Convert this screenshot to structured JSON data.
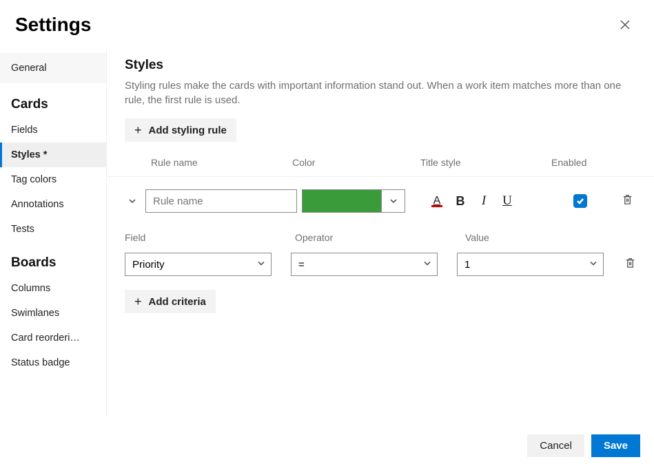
{
  "header": {
    "title": "Settings"
  },
  "sidebar": {
    "items": [
      {
        "label": "General",
        "type": "plain-first"
      },
      {
        "label": "Cards",
        "type": "group"
      },
      {
        "label": "Fields",
        "type": "plain"
      },
      {
        "label": "Styles *",
        "type": "active"
      },
      {
        "label": "Tag colors",
        "type": "plain"
      },
      {
        "label": "Annotations",
        "type": "plain"
      },
      {
        "label": "Tests",
        "type": "plain"
      },
      {
        "label": "Boards",
        "type": "group"
      },
      {
        "label": "Columns",
        "type": "plain"
      },
      {
        "label": "Swimlanes",
        "type": "plain"
      },
      {
        "label": "Card reorderi…",
        "type": "plain"
      },
      {
        "label": "Status badge",
        "type": "plain"
      }
    ]
  },
  "main": {
    "section_title": "Styles",
    "section_desc": "Styling rules make the cards with important information stand out. When a work item matches more than one rule, the first rule is used.",
    "add_rule_label": "Add styling rule",
    "add_criteria_label": "Add criteria",
    "columns": {
      "name": "Rule name",
      "color": "Color",
      "title_style": "Title style",
      "enabled": "Enabled"
    },
    "rule": {
      "name_value": "",
      "name_placeholder": "Rule name",
      "color": "#3a9b3a",
      "enabled": true
    },
    "criteria_columns": {
      "field": "Field",
      "operator": "Operator",
      "value": "Value"
    },
    "criteria": {
      "field": "Priority",
      "operator": "=",
      "value": "1"
    }
  },
  "footer": {
    "cancel": "Cancel",
    "save": "Save"
  }
}
